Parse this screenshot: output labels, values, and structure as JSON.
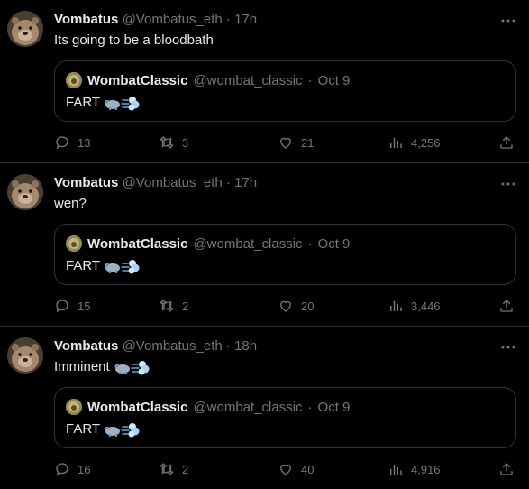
{
  "tweets": [
    {
      "author": {
        "name": "Vombatus",
        "handle": "@Vombatus_eth",
        "time": "17h"
      },
      "text": "Its going to be a bloodbath",
      "has_emoji": false,
      "quote": {
        "name": "WombatClassic",
        "handle": "@wombat_classic",
        "time": "Oct 9",
        "text": "FART"
      },
      "stats": {
        "replies": "13",
        "retweets": "3",
        "likes": "21",
        "views": "4,256"
      }
    },
    {
      "author": {
        "name": "Vombatus",
        "handle": "@Vombatus_eth",
        "time": "17h"
      },
      "text": "wen?",
      "has_emoji": false,
      "quote": {
        "name": "WombatClassic",
        "handle": "@wombat_classic",
        "time": "Oct 9",
        "text": "FART"
      },
      "stats": {
        "replies": "15",
        "retweets": "2",
        "likes": "20",
        "views": "3,446"
      }
    },
    {
      "author": {
        "name": "Vombatus",
        "handle": "@Vombatus_eth",
        "time": "18h"
      },
      "text": "Imminent",
      "has_emoji": true,
      "quote": {
        "name": "WombatClassic",
        "handle": "@wombat_classic",
        "time": "Oct 9",
        "text": "FART"
      },
      "stats": {
        "replies": "16",
        "retweets": "2",
        "likes": "40",
        "views": "4,916"
      }
    }
  ],
  "separator": "·",
  "icons": [
    "wombat-avatar",
    "more-icon",
    "reply-icon",
    "retweet-icon",
    "like-icon",
    "views-icon",
    "share-icon",
    "wombat-emoji",
    "dash-emoji"
  ],
  "colors": {
    "background": "#000000",
    "text": "#e7e9ea",
    "muted": "#71767b",
    "border": "#2f3336"
  }
}
